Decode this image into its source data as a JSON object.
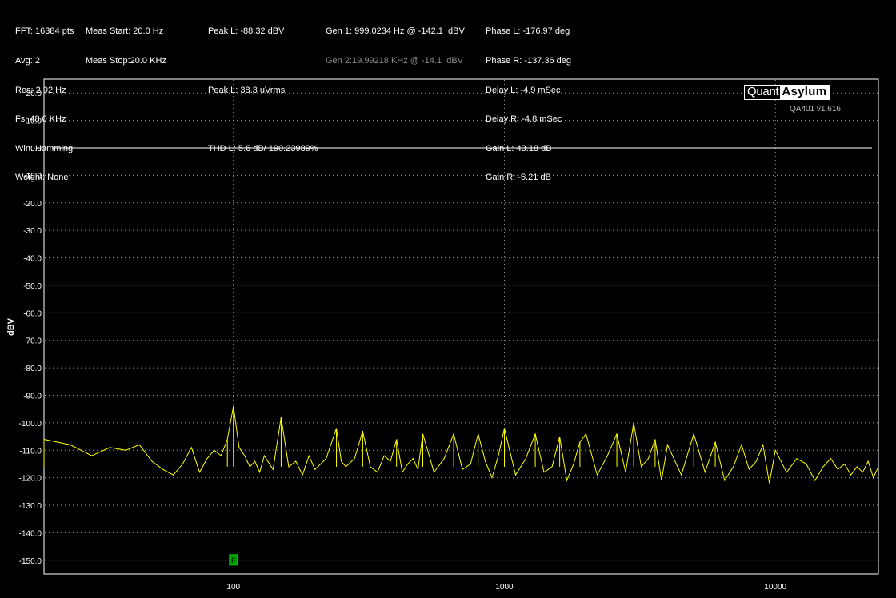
{
  "header": {
    "col1": [
      "FFT: 16384 pts",
      "Avg: 2",
      "Res: 2.92 Hz",
      "Fs: 48.0 KHz",
      "Win: Hamming",
      "Weight: None"
    ],
    "col2": [
      "Meas Start: 20.0 Hz",
      "Meas Stop:20.0 KHz"
    ],
    "col3": {
      "peak_l_dbv": "Peak L: -88.32 dBV",
      "peak_l_vrms": "Peak L: 38.3 uVrms",
      "thd": "THD L: 5.6 dB/ 190.23989%"
    },
    "col4": {
      "gen1": "Gen 1: 999.0234 Hz @ -142.1  dBV",
      "gen2": "Gen 2:19.99218 KHz @ -14.1  dBV"
    },
    "col5": [
      "Phase L: -176.97 deg",
      "Phase R: -137.36 deg",
      "Delay L: -4.9 mSec",
      "Delay R: -4.8 mSec",
      "Gain L: 43.18 dB",
      "Gain R: -5.21 dB"
    ]
  },
  "logo": {
    "part1": "Quant",
    "part2": "Asylum",
    "version": "QA401 v1.616"
  },
  "colors": {
    "background": "#000000",
    "grid": "#9a9a9a",
    "trace": "#ffff00",
    "reference_line": "#ffffff",
    "marker": "#00a000"
  },
  "chart_data": {
    "type": "line",
    "x_scale": "log",
    "xlim": [
      20,
      24000
    ],
    "ylim": [
      -155,
      25
    ],
    "ylabel": "dBV",
    "xlabel": "",
    "x_tick_labels": [
      "100",
      "1000",
      "10000"
    ],
    "y_tick_labels": [
      "20.0",
      "10.0",
      "0.0",
      "-10.0",
      "-20.0",
      "-30.0",
      "-40.0",
      "-50.0",
      "-60.0",
      "-70.0",
      "-80.0",
      "-90.0",
      "-100.0",
      "-110.0",
      "-120.0",
      "-130.0",
      "-140.0",
      "-150.0"
    ],
    "reference_line_dbv": 0,
    "marker": {
      "frequency_hz": 100,
      "level_dbv": -150,
      "label": "F"
    },
    "series": [
      {
        "x": [
          20,
          25,
          30,
          35,
          40,
          45,
          50,
          55,
          60,
          65,
          70,
          75,
          80,
          85,
          90,
          95,
          100,
          105,
          110,
          115,
          120,
          125,
          130,
          140,
          150,
          160,
          170,
          180,
          190,
          200,
          210,
          220,
          240,
          250,
          260,
          280,
          300,
          320,
          340,
          360,
          380,
          400,
          420,
          440,
          460,
          480,
          500,
          550,
          600,
          650,
          700,
          750,
          800,
          850,
          900,
          950,
          1000,
          1100,
          1200,
          1300,
          1400,
          1500,
          1600,
          1700,
          1800,
          1900,
          2000,
          2200,
          2400,
          2600,
          2800,
          3000,
          3200,
          3400,
          3600,
          3800,
          4000,
          4500,
          5000,
          5500,
          6000,
          6500,
          7000,
          7500,
          8000,
          8500,
          9000,
          9500,
          10000,
          11000,
          12000,
          13000,
          14000,
          15000,
          16000,
          17000,
          18000,
          19000,
          20000,
          21000,
          22000,
          23000,
          24000
        ],
        "y": [
          -106,
          -108,
          -112,
          -109,
          -110,
          -108,
          -114,
          -117,
          -119,
          -115,
          -109,
          -118,
          -113,
          -110,
          -112,
          -106,
          -94,
          -109,
          -112,
          -116,
          -114,
          -118,
          -112,
          -117,
          -98,
          -116,
          -114,
          -119,
          -112,
          -117,
          -115,
          -113,
          -102,
          -114,
          -116,
          -113,
          -103,
          -116,
          -118,
          -112,
          -114,
          -106,
          -118,
          -115,
          -113,
          -117,
          -104,
          -118,
          -113,
          -104,
          -117,
          -115,
          -104,
          -114,
          -120,
          -112,
          -102,
          -119,
          -113,
          -104,
          -118,
          -116,
          -105,
          -121,
          -115,
          -107,
          -104,
          -119,
          -112,
          -104,
          -118,
          -100,
          -116,
          -113,
          -106,
          -121,
          -108,
          -119,
          -104,
          -118,
          -107,
          -121,
          -116,
          -108,
          -117,
          -114,
          -108,
          -122,
          -110,
          -118,
          -113,
          -115,
          -121,
          -116,
          -113,
          -117,
          -115,
          -119,
          -116,
          -118,
          -114,
          -120,
          -116
        ]
      }
    ]
  }
}
